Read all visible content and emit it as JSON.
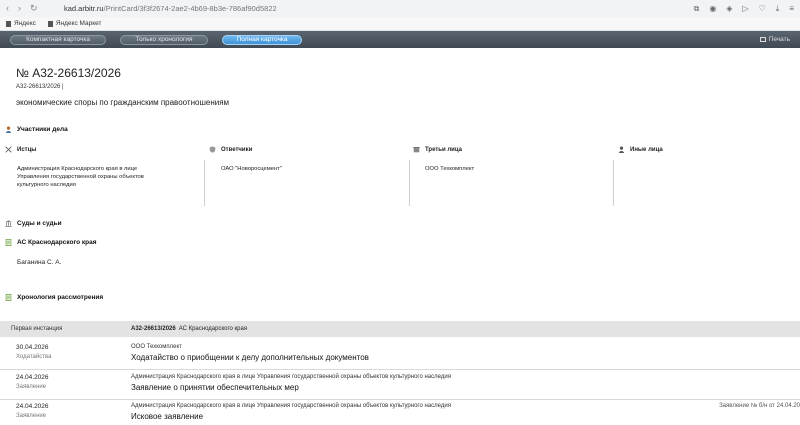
{
  "browser": {
    "url_host": "kad.arbitr.ru",
    "url_path": "/PrintCard/3f3f2674-2ae2-4b69-8b3e-786af90d5822",
    "bookmarks": [
      "Яндекс",
      "Яндекс Маркет"
    ]
  },
  "toolbar": {
    "buttons": [
      "Компактная карточка",
      "Только хронология",
      "Полная карточка"
    ],
    "active_index": 2,
    "print_label": "Печать"
  },
  "case": {
    "number": "№ А32-26613/2026",
    "subnumber": "А32-26613/2026 |",
    "category": "экономические споры по гражданским правоотношениям"
  },
  "participants": {
    "title": "Участники дела",
    "columns": [
      {
        "label": "Истцы",
        "lines": [
          "Администрация Краснодарского края в лице",
          "Управления государственной охраны объектов",
          "культурного наследия"
        ]
      },
      {
        "label": "Ответчики",
        "lines": [
          "ОАО \"Новоросцемент\""
        ]
      },
      {
        "label": "Третьи лица",
        "lines": [
          "ООО Техкомплект"
        ]
      },
      {
        "label": "Иные лица",
        "lines": []
      }
    ]
  },
  "courts": {
    "title": "Суды и судьи",
    "court": "АС Краснодарского края",
    "judge": "Баганина С. А."
  },
  "chronology": {
    "title": "Хронология рассмотрения",
    "instance_label": "Первая инстанция",
    "instance_case": "А32-26613/2026",
    "instance_court": "АС Краснодарского края",
    "rows": [
      {
        "date": "30.04.2026",
        "kind": "Ходатайства",
        "party": "ООО Техкомплект",
        "doc": "Ходатайство о приобщении к делу дополнительных документов",
        "extra": ""
      },
      {
        "date": "24.04.2026",
        "kind": "Заявление",
        "party": "Администрация Краснодарского края в лице Управления государственной охраны объектов культурного наследия",
        "doc": "Заявление о принятии обеспечительных мер",
        "extra": ""
      },
      {
        "date": "24.04.2026",
        "kind": "Заявление",
        "party": "Администрация Краснодарского края в лице Управления государственной охраны объектов культурного наследия",
        "doc": "Исковое заявление",
        "extra": "Заявление № б/н от 24.04.20"
      }
    ]
  }
}
